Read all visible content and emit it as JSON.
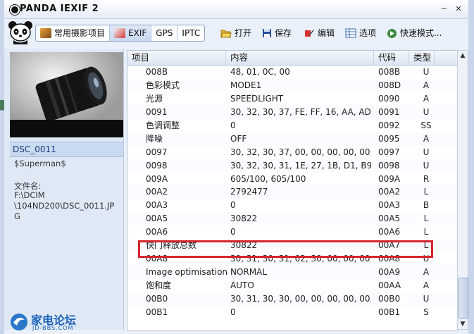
{
  "window": {
    "title": "PANDA IEXIF 2"
  },
  "tabs": [
    {
      "label": "常用摄影项目",
      "icon": "camera-icon"
    },
    {
      "label": "EXIF",
      "icon": "exif-icon"
    },
    {
      "label": "GPS"
    },
    {
      "label": "IPTC"
    }
  ],
  "toolbar": {
    "open_label": "打开",
    "save_label": "保存",
    "edit_label": "编辑",
    "options_label": "选项",
    "quick_label": "快速模式..."
  },
  "sidebar": {
    "filename": "DSC_0011",
    "author": "$Superman$",
    "file_label": "文件名:",
    "path_line1": "F:\\DCIM",
    "path_line2": "\\104ND200\\DSC_0011.JP",
    "path_line3": "G",
    "site_logo": "家电论坛",
    "site_url": "JD-BBS.COM"
  },
  "table": {
    "headers": {
      "item": "项目",
      "content": "内容",
      "code": "代码",
      "type": "类型"
    },
    "rows": [
      {
        "item": "008B",
        "content": "48, 01, 0C, 00",
        "code": "008B",
        "type": "U"
      },
      {
        "item": "色彩模式",
        "content": "MODE1",
        "code": "008D",
        "type": "A"
      },
      {
        "item": "光源",
        "content": "SPEEDLIGHT",
        "code": "0090",
        "type": "A"
      },
      {
        "item": "0091",
        "content": "30, 32, 30, 37, FE, FF, 16, AA, AD, ...",
        "code": "0091",
        "type": "U"
      },
      {
        "item": "色调调整",
        "content": "0",
        "code": "0092",
        "type": "SS"
      },
      {
        "item": "降噪",
        "content": "OFF",
        "code": "0095",
        "type": "A"
      },
      {
        "item": "0097",
        "content": "30, 32, 30, 37, 00, 00, 00, 00, 00, ...",
        "code": "0097",
        "type": "U"
      },
      {
        "item": "0098",
        "content": "30, 32, 30, 31, 1E, 27, 1B, D1, B9, ...",
        "code": "0098",
        "type": "U"
      },
      {
        "item": "009A",
        "content": "605/100, 605/100",
        "code": "009A",
        "type": "R"
      },
      {
        "item": "00A2",
        "content": "2792477",
        "code": "00A2",
        "type": "L"
      },
      {
        "item": "00A3",
        "content": "0",
        "code": "00A3",
        "type": "B"
      },
      {
        "item": "00A5",
        "content": "30822",
        "code": "00A5",
        "type": "L"
      },
      {
        "item": "00A6",
        "content": "0",
        "code": "00A6",
        "type": "L"
      },
      {
        "item": "快门释放总数",
        "content": "30822",
        "code": "00A7",
        "type": "L"
      },
      {
        "item": "00A8",
        "content": "30, 31, 30, 31, 02, 30, 00, 00, 00, ...",
        "code": "00A8",
        "type": "U"
      },
      {
        "item": "Image optimisation",
        "content": "NORMAL",
        "code": "00A9",
        "type": "A"
      },
      {
        "item": "饱和度",
        "content": "AUTO",
        "code": "00AA",
        "type": "A"
      },
      {
        "item": "00B0",
        "content": "30, 31, 30, 30, 00, 00, 00, 00, 00, ...",
        "code": "00B0",
        "type": "U"
      },
      {
        "item": "00B1",
        "content": "0",
        "code": "00B1",
        "type": "S"
      }
    ]
  },
  "colors": {
    "highlight": "#d4262b",
    "accent": "#1b3d7a"
  }
}
